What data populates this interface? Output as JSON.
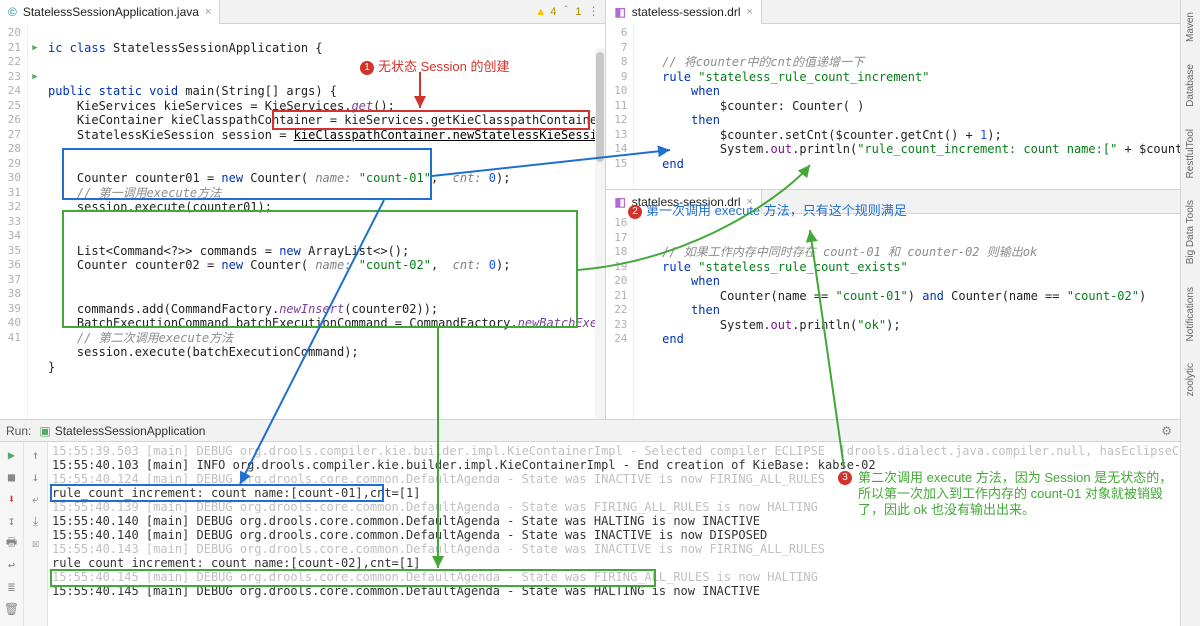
{
  "left_tab": {
    "filename": "StatelessSessionApplication.java",
    "warning_count": "4",
    "warning_err": "1"
  },
  "right_tab_top": {
    "filename": "stateless-session.drl"
  },
  "right_tab_bottom": {
    "filename": "stateless-session.drl"
  },
  "left_gutter": [
    "20",
    "21",
    "22",
    "23",
    "24",
    "25",
    "26",
    "27",
    "28",
    "29",
    "30",
    "31",
    "32",
    "33",
    "34",
    "35",
    "36",
    "37",
    "38",
    "39",
    "40",
    "41"
  ],
  "right_top_gutter": [
    "6",
    "7",
    "8",
    "9",
    "10",
    "11",
    "12",
    "13",
    "14",
    "15"
  ],
  "right_bot_gutter": [
    "16",
    "17",
    "18",
    "19",
    "20",
    "21",
    "22",
    "23",
    "24"
  ],
  "left_code": {
    "l0": "",
    "l1": "ic class StatelessSessionApplication {",
    "l2": "",
    "l3": "public static void main(String[] args) {",
    "l4": "    KieServices kieServices = KieServices.get();",
    "l5": "    KieContainer kieClasspathContainer = kieServices.getKieClasspathContainer();",
    "l6": "    StatelessKieSession session = kieClasspathContainer.newStatelessKieSession( kSessionName:",
    "l7": "",
    "l8": "    Counter counter01 = new Counter( name: \"count-01\",  cnt: 0);",
    "l9": "    // 第一调用execute方法",
    "l10": "    session.execute(counter01);",
    "l11": "",
    "l12": "    List<Command<?>> commands = new ArrayList<>();",
    "l13": "    Counter counter02 = new Counter( name: \"count-02\",  cnt: 0);",
    "l14": "",
    "l15": "    commands.add(CommandFactory.newInsert(counter02));",
    "l16": "    BatchExecutionCommand batchExecutionCommand = CommandFactory.newBatchExecution(commands);",
    "l17": "    // 第二次调用execute方法",
    "l18": "    session.execute(batchExecutionCommand);",
    "l19": "}",
    "l20": ""
  },
  "right_top_code": {
    "l0": "",
    "l1": "   // 将counter中的cnt的值递增一下",
    "l2": "   rule \"stateless_rule_count_increment\"",
    "l3": "       when",
    "l4": "           $counter: Counter( )",
    "l5": "       then",
    "l6": "           $counter.setCnt($counter.getCnt() + 1);",
    "l7": "           System.out.println(\"rule_count_increment: count name:[\" + $counter.getName()+\"],cnt=",
    "l8": "   end",
    "l9": ""
  },
  "right_bot_code": {
    "l0": "",
    "l1": "   // 如果工作内存中同时存在 count-01 和 counter-02 则输出ok",
    "l2": "   rule \"stateless_rule_count_exists\"",
    "l3": "       when",
    "l4": "           Counter(name == \"count-01\") and Counter(name == \"count-02\")",
    "l5": "       then",
    "l6": "           System.out.println(\"ok\");",
    "l7": "   end",
    "l8": ""
  },
  "callouts": {
    "c1": "无状态 Session 的创建",
    "c2": "第一次调用 execute 方法，只有这个规则满足",
    "c3": "第二次调用 execute 方法，因为 Session 是无状态的，所以第一次加入到工作内存的 count-01 对象就被销毁了，因此 ok 也没有输出出来。"
  },
  "run": {
    "title": "StatelessSessionApplication",
    "label": "Run:",
    "lines": [
      "15:55:39.503 [main] DEBUG org.drools.compiler.kie.builder.impl.KieContainerImpl - Selected compiler ECLIPSE  [drools.dialect.java.compiler.null, hasEclipseCompiler:true]",
      "15:55:40.103 [main] INFO org.drools.compiler.kie.builder.impl.KieContainerImpl - End creation of KieBase: kabse-02",
      "15:55:40.124 [main] DEBUG org.drools.core.common.DefaultAgenda - State was INACTIVE is now FIRING_ALL_RULES",
      "rule_count_increment: count name:[count-01],cnt=[1]",
      "15:55:40.139 [main] DEBUG org.drools.core.common.DefaultAgenda - State was FIRING_ALL_RULES is now HALTING",
      "15:55:40.140 [main] DEBUG org.drools.core.common.DefaultAgenda - State was HALTING is now INACTIVE",
      "15:55:40.140 [main] DEBUG org.drools.core.common.DefaultAgenda - State was INACTIVE is now DISPOSED",
      "15:55:40.143 [main] DEBUG org.drools.core.common.DefaultAgenda - State was INACTIVE is now FIRING_ALL_RULES",
      "rule_count_increment: count name:[count-02],cnt=[1]",
      "15:55:40.145 [main] DEBUG org.drools.core.common.DefaultAgenda - State was FIRING_ALL_RULES is now HALTING",
      "15:55:40.145 [main] DEBUG org.drools.core.common.DefaultAgenda - State was HALTING is now INACTIVE"
    ]
  },
  "toolstrip": {
    "items": [
      "Maven",
      "Database",
      "RestfulTool",
      "Big Data Tools",
      "Notifications",
      "zoolytic"
    ]
  }
}
